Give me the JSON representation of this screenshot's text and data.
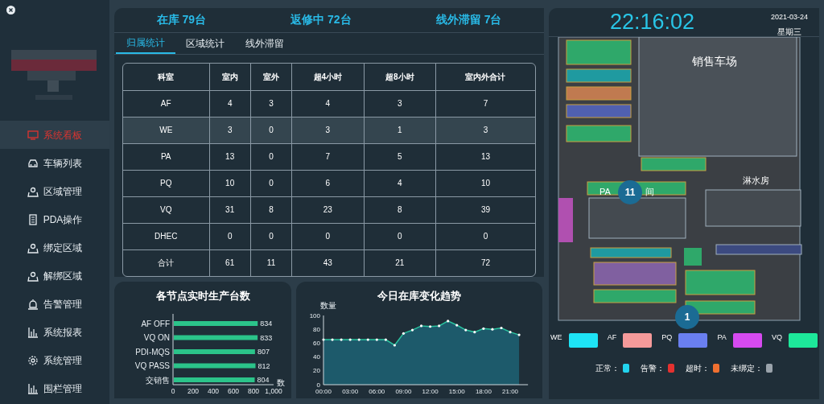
{
  "sidebar": {
    "items": [
      {
        "label": "系统看板",
        "selected": true
      },
      {
        "label": "车辆列表",
        "selected": false
      },
      {
        "label": "区域管理",
        "selected": false
      },
      {
        "label": "PDA操作",
        "selected": false
      },
      {
        "label": "绑定区域",
        "selected": false
      },
      {
        "label": "解绑区域",
        "selected": false
      },
      {
        "label": "告警管理",
        "selected": false
      },
      {
        "label": "系统报表",
        "selected": false
      },
      {
        "label": "系统管理",
        "selected": false
      },
      {
        "label": "围栏管理",
        "selected": false
      }
    ]
  },
  "summary": [
    "在库 79台",
    "返修中 72台",
    "线外滞留 7台"
  ],
  "tabs": [
    {
      "label": "归属统计",
      "selected": true
    },
    {
      "label": "区域统计",
      "selected": false
    },
    {
      "label": "线外滞留",
      "selected": false
    }
  ],
  "table": {
    "columns": [
      "科室",
      "室内",
      "室外",
      "超4小时",
      "超8小时",
      "室内外合计"
    ],
    "rows": [
      {
        "cells": [
          "AF",
          "4",
          "3",
          "4",
          "3",
          "7"
        ],
        "selected": false
      },
      {
        "cells": [
          "WE",
          "3",
          "0",
          "3",
          "1",
          "3"
        ],
        "selected": true
      },
      {
        "cells": [
          "PA",
          "13",
          "0",
          "7",
          "5",
          "13"
        ],
        "selected": false
      },
      {
        "cells": [
          "PQ",
          "10",
          "0",
          "6",
          "4",
          "10"
        ],
        "selected": false
      },
      {
        "cells": [
          "VQ",
          "31",
          "8",
          "23",
          "8",
          "39"
        ],
        "selected": false
      },
      {
        "cells": [
          "DHEC",
          "0",
          "0",
          "0",
          "0",
          "0"
        ],
        "selected": false
      },
      {
        "cells": [
          "合计",
          "61",
          "11",
          "43",
          "21",
          "72"
        ],
        "selected": false
      }
    ]
  },
  "production_chart": {
    "title": "各节点实时生产台数",
    "chart_data": {
      "type": "bar",
      "orientation": "horizontal",
      "xlabel": "数",
      "categories": [
        "AF OFF",
        "VQ ON",
        "PDI-MQS",
        "VQ PASS",
        "交销售"
      ],
      "series": [
        {
          "color": "#2bc48a",
          "values": [
            834,
            833,
            807,
            812,
            804
          ]
        }
      ],
      "xlim": [
        0,
        1000
      ],
      "xticks": [
        0,
        200,
        400,
        600,
        800,
        {
          "value": 1000,
          "label": "1,000"
        }
      ],
      "data_labels": true
    }
  },
  "trend_chart": {
    "title": "今日在库变化趋势",
    "chart_data": {
      "type": "area",
      "ylabel": "数量",
      "x": [
        0,
        1,
        2,
        3,
        4,
        5,
        6,
        7,
        8,
        9,
        10,
        11,
        12,
        13,
        14,
        15,
        16,
        17,
        18,
        19,
        20,
        21,
        22
      ],
      "series": [
        {
          "color": "#2bc4a0",
          "values": [
            65,
            65,
            65,
            65,
            65,
            65,
            65,
            65,
            57,
            74,
            79,
            85,
            84,
            85,
            92,
            86,
            79,
            76,
            81,
            80,
            82,
            76,
            72
          ]
        }
      ],
      "xlim": [
        0,
        23
      ],
      "ylim": [
        0,
        100
      ],
      "yticks": [
        0,
        20,
        40,
        60,
        80,
        100
      ],
      "xticks": [
        {
          "value": 0,
          "label": "00:00"
        },
        {
          "value": 3,
          "label": "03:00"
        },
        {
          "value": 6,
          "label": "06:00"
        },
        {
          "value": 9,
          "label": "09:00"
        },
        {
          "value": 12,
          "label": "12:00"
        },
        {
          "value": 15,
          "label": "15:00"
        },
        {
          "value": 18,
          "label": "18:00"
        },
        {
          "value": 21,
          "label": "21:00"
        }
      ]
    }
  },
  "clock": {
    "time": "22:16:02",
    "date": "2021-03-24",
    "weekday": "星期三"
  },
  "map": {
    "labels": [
      "销售车场",
      "淋水房",
      "PA",
      "间"
    ],
    "markers": [
      "11",
      "1"
    ]
  },
  "zone_legend": [
    {
      "label": "WE",
      "color": "#1ee3f5"
    },
    {
      "label": "AF",
      "color": "#f59a9a"
    },
    {
      "label": "PQ",
      "color": "#6a7ff0"
    },
    {
      "label": "PA",
      "color": "#d64af0"
    },
    {
      "label": "VQ",
      "color": "#1de89a"
    }
  ],
  "status_legend": [
    {
      "label": "正常：",
      "color": "#22d3ee"
    },
    {
      "label": "告警：",
      "color": "#e5312f"
    },
    {
      "label": "超时：",
      "color": "#f07030"
    },
    {
      "label": "未绑定：",
      "color": "#9aa3ab"
    }
  ]
}
